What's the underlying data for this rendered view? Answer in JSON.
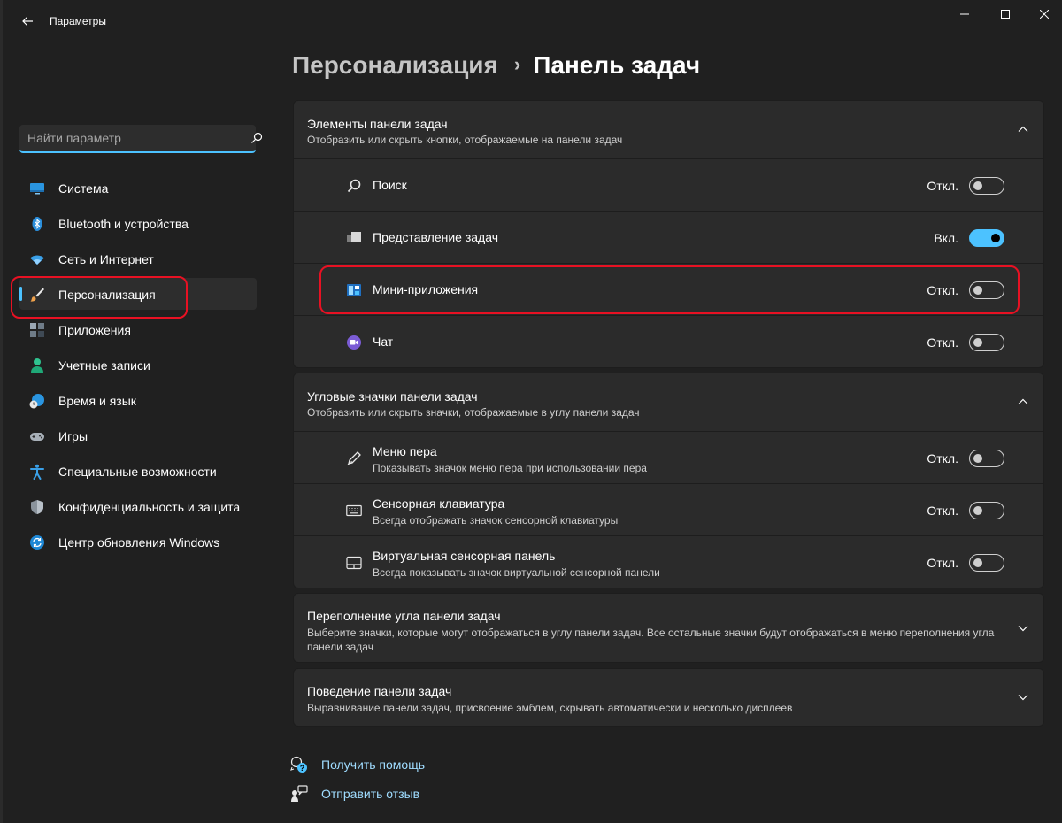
{
  "window": {
    "title": "Параметры",
    "accent": "#4cc2ff",
    "highlight": "#e81123"
  },
  "sidebar": {
    "search": {
      "placeholder": "Найти параметр",
      "value": ""
    },
    "items": [
      {
        "label": "Система",
        "icon": "monitor-icon",
        "active": false
      },
      {
        "label": "Bluetooth и устройства",
        "icon": "bluetooth-icon",
        "active": false
      },
      {
        "label": "Сеть и Интернет",
        "icon": "wifi-icon",
        "active": false
      },
      {
        "label": "Персонализация",
        "icon": "brush-icon",
        "active": true
      },
      {
        "label": "Приложения",
        "icon": "apps-icon",
        "active": false
      },
      {
        "label": "Учетные записи",
        "icon": "person-icon",
        "active": false
      },
      {
        "label": "Время и язык",
        "icon": "globe-clock-icon",
        "active": false
      },
      {
        "label": "Игры",
        "icon": "gamepad-icon",
        "active": false
      },
      {
        "label": "Специальные возможности",
        "icon": "accessibility-icon",
        "active": false
      },
      {
        "label": "Конфиденциальность и защита",
        "icon": "shield-icon",
        "active": false
      },
      {
        "label": "Центр обновления Windows",
        "icon": "update-icon",
        "active": false
      }
    ]
  },
  "header": {
    "parent": "Персонализация",
    "separator": "›",
    "current": "Панель задач"
  },
  "sections": {
    "items": {
      "title": "Элементы панели задач",
      "subtitle": "Отобразить или скрыть кнопки, отображаемые на панели задач",
      "rows": [
        {
          "label": "Поиск",
          "icon": "search-icon",
          "state_text": "Откл.",
          "on": false
        },
        {
          "label": "Представление задач",
          "icon": "task-view-icon",
          "state_text": "Вкл.",
          "on": true
        },
        {
          "label": "Мини-приложения",
          "icon": "widgets-icon",
          "state_text": "Откл.",
          "on": false
        },
        {
          "label": "Чат",
          "icon": "chat-icon",
          "state_text": "Откл.",
          "on": false
        }
      ]
    },
    "corner": {
      "title": "Угловые значки панели задач",
      "subtitle": "Отобразить или скрыть значки, отображаемые в углу панели задач",
      "rows": [
        {
          "label": "Меню пера",
          "desc": "Показывать значок меню пера при использовании пера",
          "icon": "pen-icon",
          "state_text": "Откл.",
          "on": false
        },
        {
          "label": "Сенсорная клавиатура",
          "desc": "Всегда отображать значок сенсорной клавиатуры",
          "icon": "keyboard-icon",
          "state_text": "Откл.",
          "on": false
        },
        {
          "label": "Виртуальная сенсорная панель",
          "desc": "Всегда показывать значок виртуальной сенсорной панели",
          "icon": "touchpad-icon",
          "state_text": "Откл.",
          "on": false
        }
      ]
    },
    "overflow": {
      "title": "Переполнение угла панели задач",
      "subtitle": "Выберите значки, которые могут отображаться в углу панели задач. Все остальные значки будут отображаться в меню переполнения угла панели задач"
    },
    "behavior": {
      "title": "Поведение панели задач",
      "subtitle": "Выравнивание панели задач, присвоение эмблем, скрывать автоматически и несколько дисплеев"
    }
  },
  "footer": {
    "help": "Получить помощь",
    "feedback": "Отправить отзыв"
  }
}
